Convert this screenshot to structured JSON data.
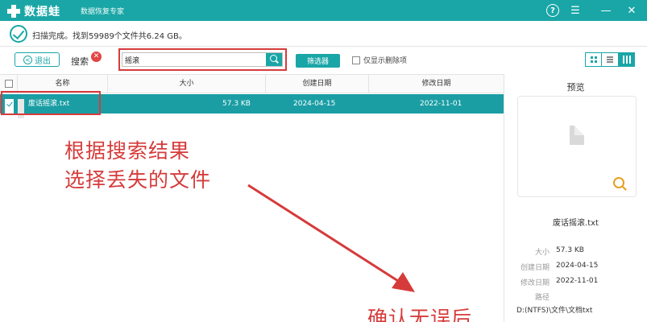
{
  "app": {
    "logo_text": "数据蛙",
    "subtitle": "数据恢复专家"
  },
  "scan": {
    "status": "扫描完成。找到59989个文件共6.24 GB。"
  },
  "toolbar": {
    "back_label": "退出",
    "search_label": "搜索",
    "search_value": "摇滚",
    "filter_label": "筛选器",
    "only_deleted_label": "仅显示删除项"
  },
  "table": {
    "columns": [
      "名称",
      "大小",
      "创建日期",
      "修改日期"
    ],
    "rows": [
      {
        "name": "废话摇滚.txt",
        "size": "57.3 KB",
        "created": "2024-04-15",
        "modified": "2022-11-01"
      }
    ]
  },
  "annotations": {
    "line1": "根据搜索结果",
    "line2": "选择丢失的文件",
    "line3": "确认无误后"
  },
  "preview": {
    "title": "预览",
    "filename": "废话摇滚.txt",
    "size_label": "大小",
    "size_value": "57.3 KB",
    "created_label": "创建日期",
    "created_value": "2024-04-15",
    "modified_label": "修改日期",
    "modified_value": "2022-11-01",
    "path_label": "路径",
    "path_value": "D:(NTFS)\\文件\\文档txt"
  },
  "colors": {
    "accent": "#1aa6a6",
    "selected_row": "#1a9ea4",
    "annotation_red": "#d63b3b"
  },
  "icons": [
    "app-logo-icon",
    "help-icon",
    "menu-icon",
    "minimize-icon",
    "close-icon",
    "scan-complete-icon",
    "back-arrow-icon",
    "clear-search-icon",
    "search-icon",
    "grid-view-icon",
    "list-view-icon",
    "detail-view-icon",
    "file-icon",
    "document-icon",
    "zoom-icon"
  ]
}
